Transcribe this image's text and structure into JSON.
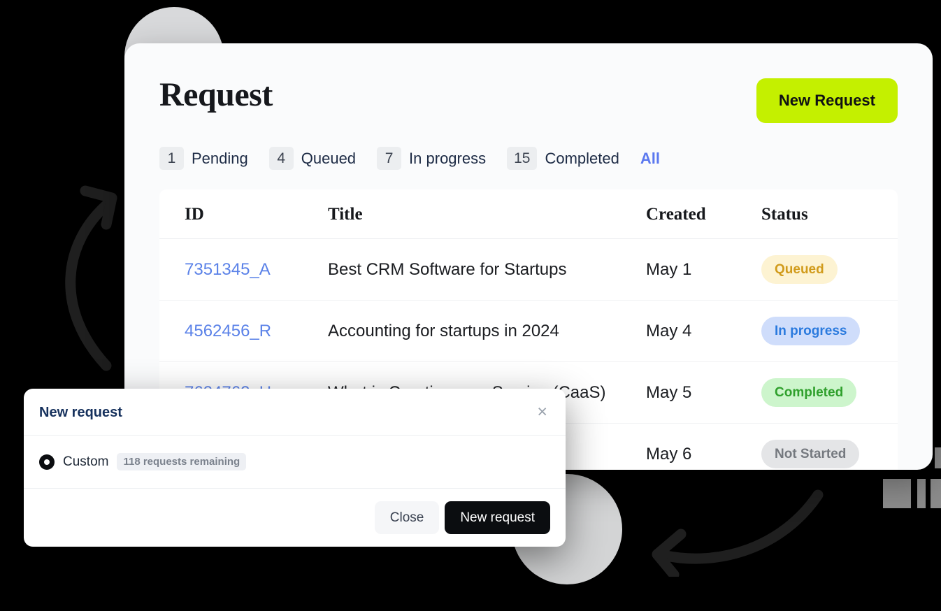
{
  "header": {
    "title": "Request",
    "new_request_button": "New Request"
  },
  "tabs": [
    {
      "count": "1",
      "label": "Pending"
    },
    {
      "count": "4",
      "label": "Queued"
    },
    {
      "count": "7",
      "label": "In progress"
    },
    {
      "count": "15",
      "label": "Completed"
    }
  ],
  "tab_all": "All",
  "table": {
    "columns": [
      "ID",
      "Title",
      "Created",
      "Status"
    ],
    "rows": [
      {
        "id": "7351345_A",
        "title": "Best CRM Software for Startups",
        "created": "May 1",
        "status": "Queued"
      },
      {
        "id": "4562456_R",
        "title": "Accounting for startups in 2024",
        "created": "May 4",
        "status": "In progress"
      },
      {
        "id": "7634762_H",
        "title": "What is Creative as a Service (CaaS)",
        "created": "May 5",
        "status": "Completed"
      },
      {
        "id": "",
        "title": "",
        "created": "May 6",
        "status": "Not Started"
      }
    ]
  },
  "modal": {
    "title": "New request",
    "close_icon": "close-icon",
    "option_label": "Custom",
    "option_note": "118 requests remaining",
    "close_button": "Close",
    "submit_button": "New request"
  },
  "colors": {
    "accent_green": "#c4f000",
    "link_blue": "#5b82e8",
    "all_blue": "#5b78ef",
    "badge_queued_bg": "#fdf3d2",
    "badge_queued_fg": "#d19b1b",
    "badge_inprogress_bg": "#cfddfb",
    "badge_inprogress_fg": "#2a7ade",
    "badge_completed_bg": "#cdf5cc",
    "badge_completed_fg": "#2fa02c",
    "badge_notstarted_bg": "#e4e5e7",
    "badge_notstarted_fg": "#75797f",
    "page_background": "#000000",
    "card_background": "#fafbfc"
  }
}
